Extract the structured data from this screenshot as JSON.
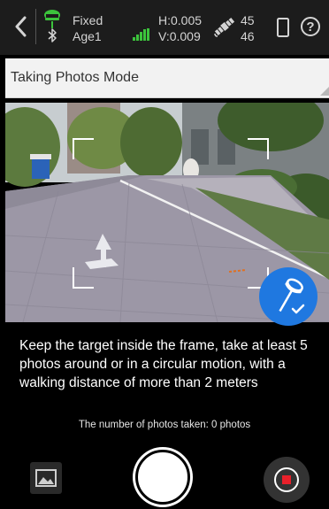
{
  "status_bar": {
    "fix_status": "Fixed",
    "age": "Age1",
    "h_accuracy": "H:0.005",
    "v_accuracy": "V:0.009",
    "satellites_used": "45",
    "satellites_tracked": "46",
    "help_glyph": "?",
    "icons": [
      "back-icon",
      "gnss-receiver-icon",
      "bluetooth-icon",
      "signal-strength-icon",
      "satellite-icon",
      "phone-icon",
      "help-icon"
    ],
    "signal_color": "#3cc43c",
    "gnss_icon_color": "#3cc43c"
  },
  "mode_bar": {
    "label": "Taking Photos Mode"
  },
  "camera": {
    "badge_color": "#1f78e0",
    "badge_icon": "gnss-pole-check-icon"
  },
  "instructions": {
    "text": "Keep the target inside the frame, take at least 5 photos around or in a circular motion, with a walking distance of more than 2 meters"
  },
  "photo_count": {
    "text": "The number of photos taken: 0 photos"
  },
  "controls": {
    "gallery_icon": "gallery-icon",
    "shutter": "shutter-button",
    "record_icon": "record-icon",
    "record_color": "#e8202a"
  }
}
